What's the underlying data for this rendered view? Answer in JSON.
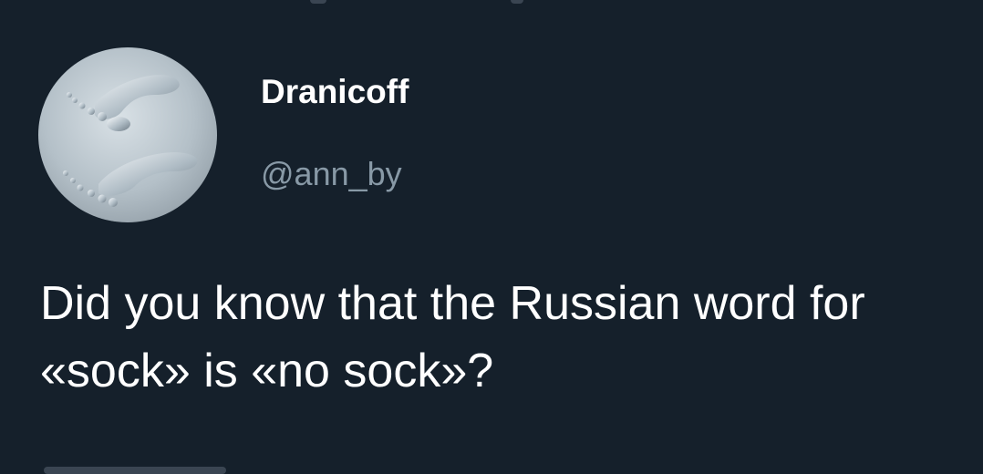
{
  "author": {
    "display_name": "Dranicoff",
    "handle": "@ann_by"
  },
  "tweet": {
    "text": "Did you know that the Russian word for «sock» is «no sock»?"
  },
  "avatar": {
    "icon": "footprints-icon",
    "alt": ""
  },
  "colors": {
    "background": "#15202b",
    "primary_text": "#ffffff",
    "secondary_text": "#8899a6"
  }
}
